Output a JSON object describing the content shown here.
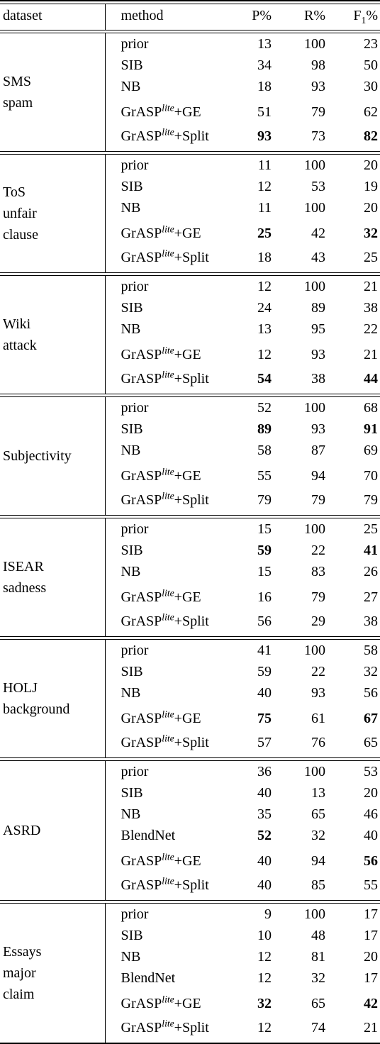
{
  "table": {
    "headers": {
      "dataset": "dataset",
      "method": "method",
      "p": "P%",
      "r": "R%",
      "f1_base": "F",
      "f1_sub": "1",
      "f1_pct": "%"
    },
    "method_labels": {
      "prior": "prior",
      "sib": "SIB",
      "nb": "NB",
      "blendnet": "BlendNet",
      "grasp_base": "GrASP",
      "grasp_sup": "lite",
      "grasp_ge_suffix": "+GE",
      "grasp_split_suffix": "+Split"
    },
    "sections": [
      {
        "dataset": "SMS\nspam",
        "rows": [
          {
            "method_key": "prior",
            "p": "13",
            "r": "100",
            "f1": "23",
            "bold_p": false,
            "bold_r": false,
            "bold_f1": false
          },
          {
            "method_key": "sib",
            "p": "34",
            "r": "98",
            "f1": "50",
            "bold_p": false,
            "bold_r": false,
            "bold_f1": false
          },
          {
            "method_key": "nb",
            "p": "18",
            "r": "93",
            "f1": "30",
            "bold_p": false,
            "bold_r": false,
            "bold_f1": false
          },
          {
            "method_key": "grasp_ge",
            "p": "51",
            "r": "79",
            "f1": "62",
            "bold_p": false,
            "bold_r": false,
            "bold_f1": false
          },
          {
            "method_key": "grasp_split",
            "p": "93",
            "r": "73",
            "f1": "82",
            "bold_p": true,
            "bold_r": false,
            "bold_f1": true
          }
        ]
      },
      {
        "dataset": "ToS\nunfair\nclause",
        "rows": [
          {
            "method_key": "prior",
            "p": "11",
            "r": "100",
            "f1": "20",
            "bold_p": false,
            "bold_r": false,
            "bold_f1": false
          },
          {
            "method_key": "sib",
            "p": "12",
            "r": "53",
            "f1": "19",
            "bold_p": false,
            "bold_r": false,
            "bold_f1": false
          },
          {
            "method_key": "nb",
            "p": "11",
            "r": "100",
            "f1": "20",
            "bold_p": false,
            "bold_r": false,
            "bold_f1": false
          },
          {
            "method_key": "grasp_ge",
            "p": "25",
            "r": "42",
            "f1": "32",
            "bold_p": true,
            "bold_r": false,
            "bold_f1": true
          },
          {
            "method_key": "grasp_split",
            "p": "18",
            "r": "43",
            "f1": "25",
            "bold_p": false,
            "bold_r": false,
            "bold_f1": false
          }
        ]
      },
      {
        "dataset": "Wiki\nattack",
        "rows": [
          {
            "method_key": "prior",
            "p": "12",
            "r": "100",
            "f1": "21",
            "bold_p": false,
            "bold_r": false,
            "bold_f1": false
          },
          {
            "method_key": "sib",
            "p": "24",
            "r": "89",
            "f1": "38",
            "bold_p": false,
            "bold_r": false,
            "bold_f1": false
          },
          {
            "method_key": "nb",
            "p": "13",
            "r": "95",
            "f1": "22",
            "bold_p": false,
            "bold_r": false,
            "bold_f1": false
          },
          {
            "method_key": "grasp_ge",
            "p": "12",
            "r": "93",
            "f1": "21",
            "bold_p": false,
            "bold_r": false,
            "bold_f1": false
          },
          {
            "method_key": "grasp_split",
            "p": "54",
            "r": "38",
            "f1": "44",
            "bold_p": true,
            "bold_r": false,
            "bold_f1": true
          }
        ]
      },
      {
        "dataset": "Subjectivity",
        "rows": [
          {
            "method_key": "prior",
            "p": "52",
            "r": "100",
            "f1": "68",
            "bold_p": false,
            "bold_r": false,
            "bold_f1": false
          },
          {
            "method_key": "sib",
            "p": "89",
            "r": "93",
            "f1": "91",
            "bold_p": true,
            "bold_r": false,
            "bold_f1": true
          },
          {
            "method_key": "nb",
            "p": "58",
            "r": "87",
            "f1": "69",
            "bold_p": false,
            "bold_r": false,
            "bold_f1": false
          },
          {
            "method_key": "grasp_ge",
            "p": "55",
            "r": "94",
            "f1": "70",
            "bold_p": false,
            "bold_r": false,
            "bold_f1": false
          },
          {
            "method_key": "grasp_split",
            "p": "79",
            "r": "79",
            "f1": "79",
            "bold_p": false,
            "bold_r": false,
            "bold_f1": false
          }
        ]
      },
      {
        "dataset": "ISEAR\nsadness",
        "rows": [
          {
            "method_key": "prior",
            "p": "15",
            "r": "100",
            "f1": "25",
            "bold_p": false,
            "bold_r": false,
            "bold_f1": false
          },
          {
            "method_key": "sib",
            "p": "59",
            "r": "22",
            "f1": "41",
            "bold_p": true,
            "bold_r": false,
            "bold_f1": true
          },
          {
            "method_key": "nb",
            "p": "15",
            "r": "83",
            "f1": "26",
            "bold_p": false,
            "bold_r": false,
            "bold_f1": false
          },
          {
            "method_key": "grasp_ge",
            "p": "16",
            "r": "79",
            "f1": "27",
            "bold_p": false,
            "bold_r": false,
            "bold_f1": false
          },
          {
            "method_key": "grasp_split",
            "p": "56",
            "r": "29",
            "f1": "38",
            "bold_p": false,
            "bold_r": false,
            "bold_f1": false
          }
        ]
      },
      {
        "dataset": "HOLJ\nbackground",
        "rows": [
          {
            "method_key": "prior",
            "p": "41",
            "r": "100",
            "f1": "58",
            "bold_p": false,
            "bold_r": false,
            "bold_f1": false
          },
          {
            "method_key": "sib",
            "p": "59",
            "r": "22",
            "f1": "32",
            "bold_p": false,
            "bold_r": false,
            "bold_f1": false
          },
          {
            "method_key": "nb",
            "p": "40",
            "r": "93",
            "f1": "56",
            "bold_p": false,
            "bold_r": false,
            "bold_f1": false
          },
          {
            "method_key": "grasp_ge",
            "p": "75",
            "r": "61",
            "f1": "67",
            "bold_p": true,
            "bold_r": false,
            "bold_f1": true
          },
          {
            "method_key": "grasp_split",
            "p": "57",
            "r": "76",
            "f1": "65",
            "bold_p": false,
            "bold_r": false,
            "bold_f1": false
          }
        ]
      },
      {
        "dataset": "ASRD",
        "rows": [
          {
            "method_key": "prior",
            "p": "36",
            "r": "100",
            "f1": "53",
            "bold_p": false,
            "bold_r": false,
            "bold_f1": false
          },
          {
            "method_key": "sib",
            "p": "40",
            "r": "13",
            "f1": "20",
            "bold_p": false,
            "bold_r": false,
            "bold_f1": false
          },
          {
            "method_key": "nb",
            "p": "35",
            "r": "65",
            "f1": "46",
            "bold_p": false,
            "bold_r": false,
            "bold_f1": false
          },
          {
            "method_key": "blendnet",
            "p": "52",
            "r": "32",
            "f1": "40",
            "bold_p": true,
            "bold_r": false,
            "bold_f1": false
          },
          {
            "method_key": "grasp_ge",
            "p": "40",
            "r": "94",
            "f1": "56",
            "bold_p": false,
            "bold_r": false,
            "bold_f1": true
          },
          {
            "method_key": "grasp_split",
            "p": "40",
            "r": "85",
            "f1": "55",
            "bold_p": false,
            "bold_r": false,
            "bold_f1": false
          }
        ]
      },
      {
        "dataset": "Essays\nmajor\nclaim",
        "rows": [
          {
            "method_key": "prior",
            "p": "9",
            "r": "100",
            "f1": "17",
            "bold_p": false,
            "bold_r": false,
            "bold_f1": false
          },
          {
            "method_key": "sib",
            "p": "10",
            "r": "48",
            "f1": "17",
            "bold_p": false,
            "bold_r": false,
            "bold_f1": false
          },
          {
            "method_key": "nb",
            "p": "12",
            "r": "81",
            "f1": "20",
            "bold_p": false,
            "bold_r": false,
            "bold_f1": false
          },
          {
            "method_key": "blendnet",
            "p": "12",
            "r": "32",
            "f1": "17",
            "bold_p": false,
            "bold_r": false,
            "bold_f1": false
          },
          {
            "method_key": "grasp_ge",
            "p": "32",
            "r": "65",
            "f1": "42",
            "bold_p": true,
            "bold_r": false,
            "bold_f1": true
          },
          {
            "method_key": "grasp_split",
            "p": "12",
            "r": "74",
            "f1": "21",
            "bold_p": false,
            "bold_r": false,
            "bold_f1": false
          }
        ]
      }
    ]
  }
}
